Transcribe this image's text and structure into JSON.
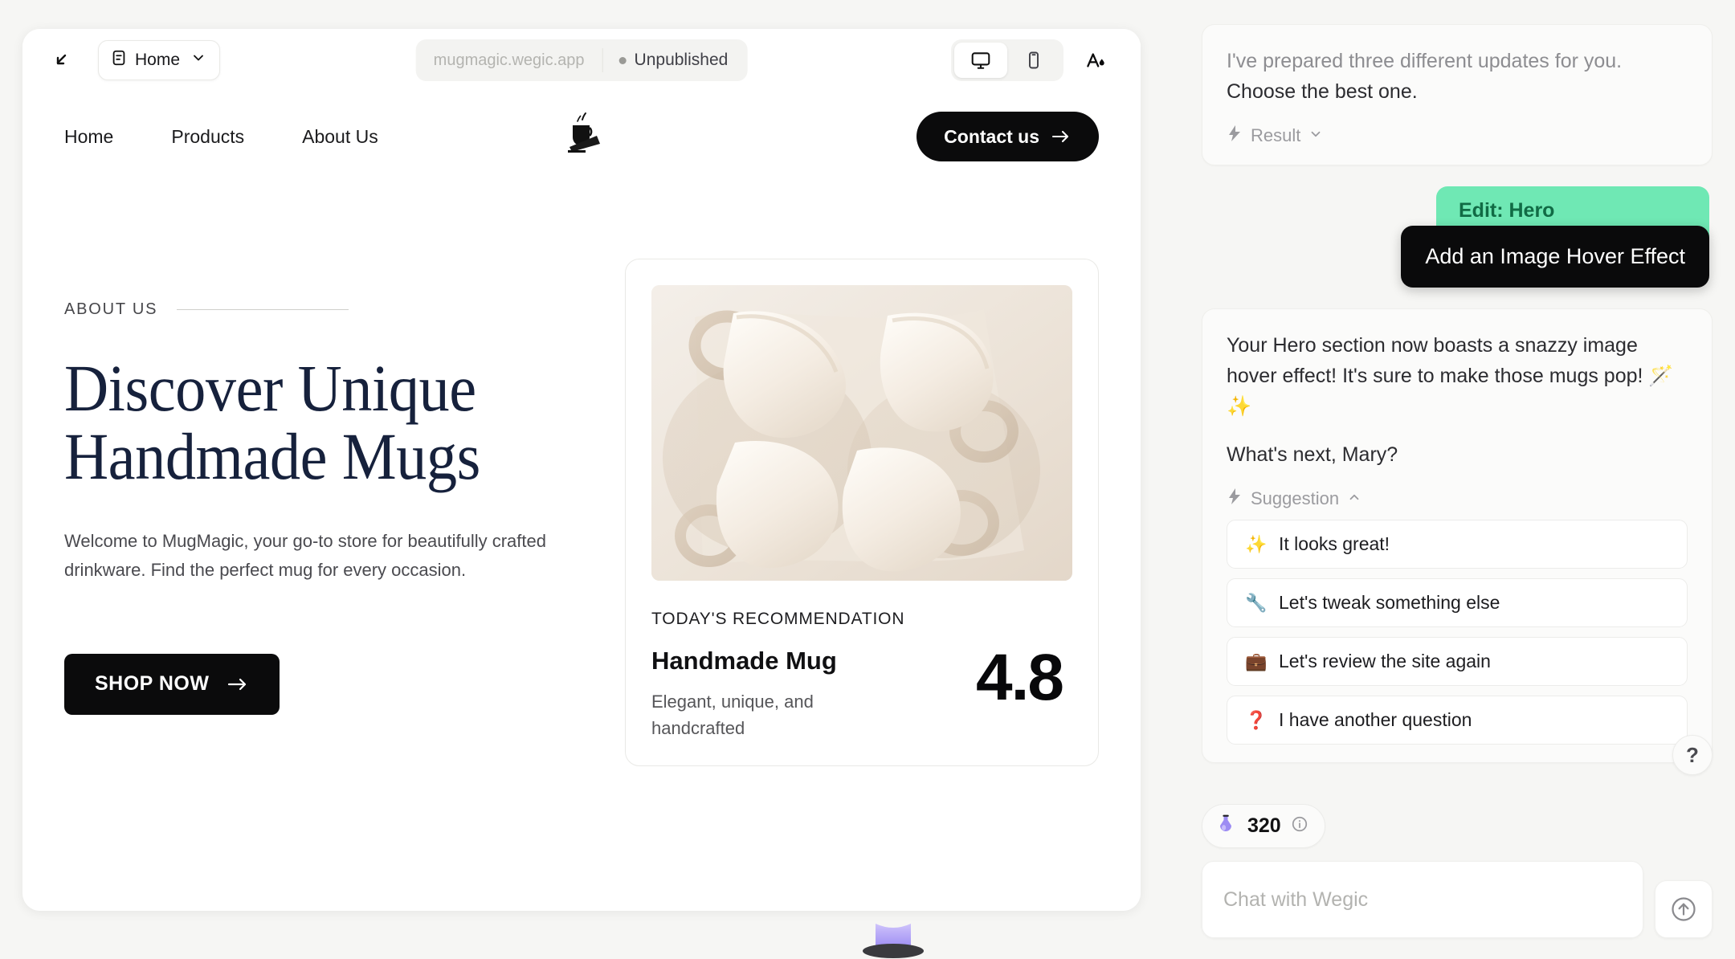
{
  "toolbar": {
    "expand_icon": "expand-arrow-icon",
    "page_label": "Home",
    "page_icon": "page-icon",
    "chevron_icon": "chevron-down-icon",
    "url": "mugmagic.wegic.app",
    "publish_state": "Unpublished",
    "desktop_icon": "desktop-icon",
    "mobile_icon": "mobile-icon",
    "theme_icon": "theme-color-icon"
  },
  "site": {
    "nav": [
      {
        "label": "Home"
      },
      {
        "label": "Products"
      },
      {
        "label": "About Us"
      }
    ],
    "logo_icon": "mug-logo-icon",
    "contact_label": "Contact us",
    "hero": {
      "eyebrow": "ABOUT US",
      "title_line1": "Discover Unique",
      "title_line2": "Handmade Mugs",
      "description": "Welcome to MugMagic, your go-to store for beautifully crafted drinkware. Find the perfect mug for every occasion.",
      "cta_label": "SHOP NOW"
    },
    "recommendation": {
      "label": "TODAY'S RECOMMENDATION",
      "name": "Handmade Mug",
      "subtitle": "Elegant, unique, and handcrafted",
      "score": "4.8",
      "photo_alt": "four cream handmade ceramic mugs"
    }
  },
  "chat": {
    "messages": [
      {
        "type": "ai",
        "line1": "I've prepared three different updates for you.",
        "line2": "Choose the best one.",
        "meta_label": "Result",
        "meta_icon": "lightning-icon",
        "meta_chevron": "chevron-down-icon"
      },
      {
        "type": "user",
        "badge": "Edit: Hero",
        "text": "Add an Image Hover Effect"
      },
      {
        "type": "ai",
        "line1": "Your Hero section now boasts a snazzy image hover effect! It's sure to make those mugs pop! 🪄✨",
        "line2": "What's next, Mary?",
        "meta_label": "Suggestion",
        "meta_icon": "lightning-icon",
        "meta_chevron": "chevron-up-icon"
      }
    ],
    "suggestions": [
      {
        "emoji": "✨",
        "label": "It looks great!"
      },
      {
        "emoji": "🔧",
        "label": "Let's tweak something else"
      },
      {
        "emoji": "💼",
        "label": "Let's review the site again"
      },
      {
        "emoji": "❓",
        "label": "I have another question"
      }
    ],
    "credits": {
      "value": "320",
      "icon": "potion-icon",
      "info_icon": "info-icon"
    },
    "input_placeholder": "Chat with Wegic",
    "send_icon": "send-up-icon",
    "help_label": "?"
  },
  "colors": {
    "accent_green": "#6fe8b4",
    "accent_green_text": "#116b45",
    "dark": "#0a0a0b",
    "hero_navy": "#16213c",
    "credits_purple": "#8b7ff0"
  }
}
